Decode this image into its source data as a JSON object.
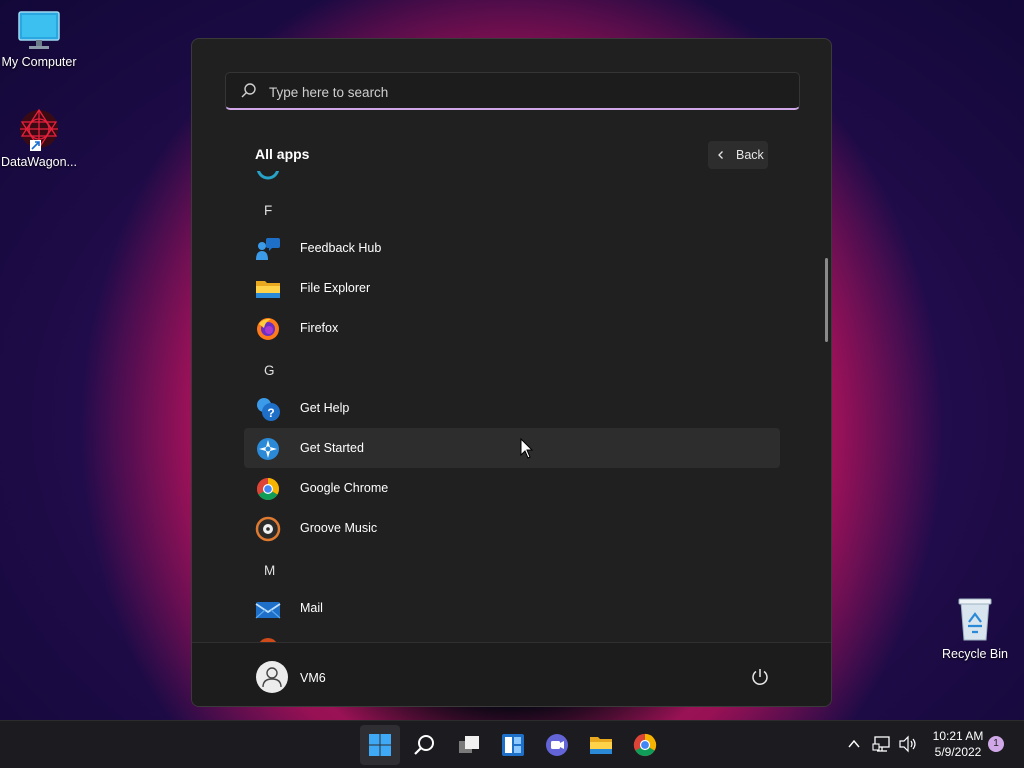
{
  "desktop": {
    "icons": [
      {
        "label": "My Computer",
        "icon": "monitor-icon"
      },
      {
        "label": "DataWagon...",
        "icon": "datawagon-icon"
      },
      {
        "label": "Recycle Bin",
        "icon": "recycle-bin-icon"
      }
    ]
  },
  "start_menu": {
    "search_placeholder": "Type here to search",
    "section_title": "All apps",
    "back_label": "Back",
    "groups": [
      {
        "letter": "F",
        "apps": [
          {
            "name": "Feedback Hub",
            "icon": "feedback-hub-icon"
          },
          {
            "name": "File Explorer",
            "icon": "file-explorer-icon"
          },
          {
            "name": "Firefox",
            "icon": "firefox-icon"
          }
        ]
      },
      {
        "letter": "G",
        "apps": [
          {
            "name": "Get Help",
            "icon": "get-help-icon"
          },
          {
            "name": "Get Started",
            "icon": "get-started-icon",
            "highlighted": true
          },
          {
            "name": "Google Chrome",
            "icon": "chrome-icon"
          },
          {
            "name": "Groove Music",
            "icon": "groove-music-icon"
          }
        ]
      },
      {
        "letter": "M",
        "apps": [
          {
            "name": "Mail",
            "icon": "mail-icon"
          }
        ]
      }
    ],
    "user": {
      "name": "VM6",
      "icon": "user-avatar-icon"
    },
    "power_icon": "power-icon"
  },
  "taskbar": {
    "buttons": [
      {
        "name": "start",
        "icon": "windows-start-icon",
        "active": true
      },
      {
        "name": "search",
        "icon": "search-icon"
      },
      {
        "name": "task-view",
        "icon": "task-view-icon"
      },
      {
        "name": "widgets",
        "icon": "widgets-icon"
      },
      {
        "name": "chat",
        "icon": "teams-chat-icon"
      },
      {
        "name": "file-explorer",
        "icon": "file-explorer-icon"
      },
      {
        "name": "chrome",
        "icon": "chrome-icon"
      }
    ],
    "tray": {
      "time": "10:21 AM",
      "date": "5/9/2022",
      "notification_count": "1"
    }
  },
  "colors": {
    "accent": "#d0a8e8",
    "menu_bg": "#202020",
    "taskbar_bg": "#1b1b20"
  }
}
